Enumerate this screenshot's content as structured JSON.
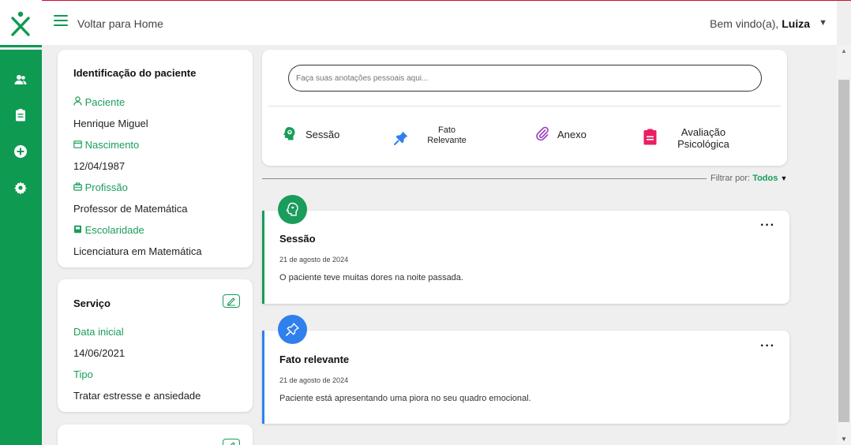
{
  "header": {
    "back_home": "Voltar para Home",
    "welcome_prefix": "Bem vindo(a), ",
    "user_name": "Luiza"
  },
  "colors": {
    "brand_green": "#0f9a52",
    "accent_green": "#1a9c5a",
    "fato_blue": "#2f80ed",
    "anexo_purple": "#9b3fc3",
    "avaliacao_pink": "#e91e63"
  },
  "sidebar": {
    "items": [
      {
        "icon": "users-icon"
      },
      {
        "icon": "clipboard-icon"
      },
      {
        "icon": "add-circle-icon"
      },
      {
        "icon": "settings-icon"
      }
    ]
  },
  "patient": {
    "title": "Identificação do paciente",
    "patient_label": "Paciente",
    "patient_value": "Henrique Miguel",
    "birth_label": "Nascimento",
    "birth_value": "12/04/1987",
    "job_label": "Profissão",
    "job_value": "Professor de Matemática",
    "edu_label": "Escolaridade",
    "edu_value": "Licenciatura em Matemática"
  },
  "service": {
    "title": "Serviço",
    "start_label": "Data inicial",
    "start_value": "14/06/2021",
    "type_label": "Tipo",
    "type_value": "Tratar estresse e ansiedade"
  },
  "notes": {
    "placeholder": "Faça suas anotações pessoais aqui...",
    "types": [
      {
        "label": "Sessão"
      },
      {
        "label_line1": "Fato",
        "label_line2": "Relevante"
      },
      {
        "label": "Anexo"
      },
      {
        "label_line1": "Avaliação",
        "label_line2": "Psicológica"
      }
    ]
  },
  "filter": {
    "prefix": "Filtrar por: ",
    "value": "Todos"
  },
  "entries": [
    {
      "title": "Sessão",
      "date": "21 de agosto de 2024",
      "text": "O paciente teve muitas dores na noite passada.",
      "more": "···"
    },
    {
      "title": "Fato relevante",
      "date": "21 de agosto de 2024",
      "text": "Paciente está apresentando uma piora no seu quadro emocional.",
      "more": "···"
    }
  ]
}
